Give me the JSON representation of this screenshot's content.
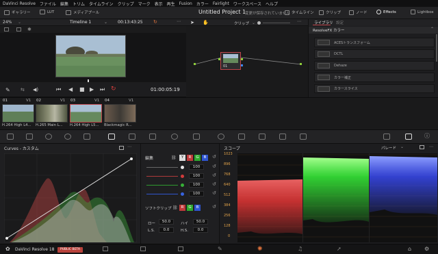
{
  "menu": [
    "DaVinci Resolve",
    "ファイル",
    "編集",
    "トリム",
    "タイムライン",
    "クリップ",
    "マーク",
    "表示",
    "再生",
    "Fusion",
    "カラー",
    "Fairlight",
    "ワークスペース",
    "ヘルプ"
  ],
  "toolbar": {
    "gallery": "ギャラリー",
    "lut": "LUT",
    "media_pool": "メディアプール",
    "project_title": "Untitled Project 1",
    "project_note": "変更が保存されていません",
    "timeline": "タイムライン",
    "clips": "クリップ",
    "nodes": "ノード",
    "effects": "Effects",
    "lightbox": "Lightbox"
  },
  "viewer": {
    "zoom": "24%",
    "timeline_name": "Timeline 1",
    "timecode_top": "00:13:43:25",
    "timecode": "01:00:05:19"
  },
  "nodes_panel": {
    "clip_label": "クリップ",
    "node_label": "01"
  },
  "library": {
    "tab_library": "ライブラリ",
    "tab_settings": "設定",
    "heading": "ResolveFX カラー",
    "items": [
      "ACESトランスフォーム",
      "DCTL",
      "Dehaze",
      "カラー補正",
      "カラースライス"
    ]
  },
  "clips": [
    {
      "num": "01",
      "track": "V1",
      "label": "H.264 High L4..."
    },
    {
      "num": "02",
      "track": "V1",
      "label": "H.265 Main L..."
    },
    {
      "num": "03",
      "track": "V1",
      "label": "H.264 High L5..."
    },
    {
      "num": "04",
      "track": "V1",
      "label": "Blackmagic R..."
    }
  ],
  "curves": {
    "title": "Curves - カスタム"
  },
  "edit": {
    "title": "編集",
    "channels": [
      "Y",
      "R",
      "G",
      "B"
    ],
    "values": [
      "100",
      "100",
      "100",
      "100"
    ],
    "soft_clip": "ソフトクリップ",
    "low_label": "ロー",
    "low_value": "50.0",
    "high_label": "ハイ",
    "high_value": "50.0",
    "ls_label": "L.S.",
    "ls_value": "0.0",
    "hs_label": "H.S.",
    "hs_value": "0.0"
  },
  "scope": {
    "title": "スコープ",
    "mode": "パレード",
    "scale": [
      "1023",
      "896",
      "768",
      "640",
      "512",
      "384",
      "256",
      "128",
      "0"
    ]
  },
  "pagebar": {
    "app": "DaVinci Resolve 18",
    "badge": "PUBLIC BETA"
  },
  "colors": {
    "accent_red": "#c0454a",
    "scope_red": "#ff3b3b",
    "scope_green": "#39ff3b",
    "scope_blue": "#3b4dff"
  }
}
